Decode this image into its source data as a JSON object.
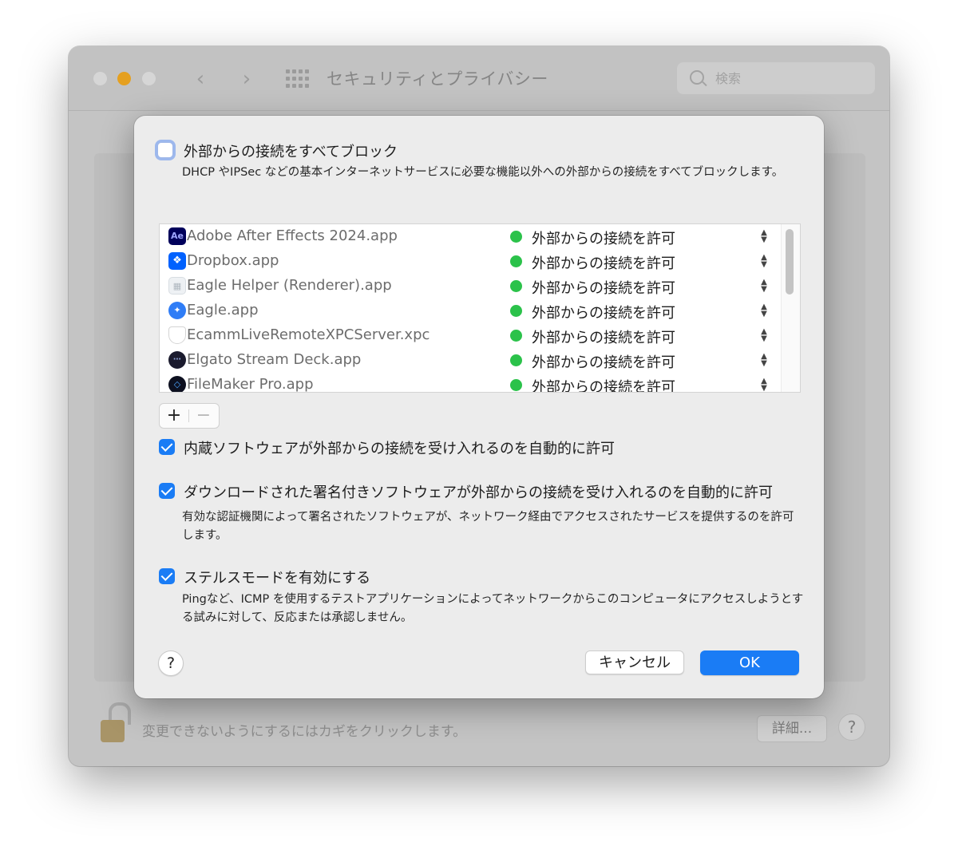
{
  "window": {
    "title": "セキュリティとプライバシー",
    "search": {
      "placeholder": "検索"
    },
    "footer": {
      "lock_text": "変更できないようにするにはカギをクリックします。",
      "detail_label": "詳細...",
      "help_label": "?"
    }
  },
  "sheet": {
    "block_all": {
      "checked": false,
      "label": "外部からの接続をすべてブロック",
      "description": "DHCP やIPSec などの基本インターネットサービスに必要な機能以外への外部からの接続をすべてブロックします。"
    },
    "apps": [
      {
        "name": "Adobe After Effects 2024.app",
        "icon": "after-effects-icon",
        "status": "外部からの接続を許可"
      },
      {
        "name": "Dropbox.app",
        "icon": "dropbox-icon",
        "status": "外部からの接続を許可"
      },
      {
        "name": "Eagle Helper (Renderer).app",
        "icon": "eagle-helper-icon",
        "status": "外部からの接続を許可"
      },
      {
        "name": "Eagle.app",
        "icon": "eagle-icon",
        "status": "外部からの接続を許可"
      },
      {
        "name": "EcammLiveRemoteXPCServer.xpc",
        "icon": "xpc-shield-icon",
        "status": "外部からの接続を許可"
      },
      {
        "name": "Elgato Stream Deck.app",
        "icon": "stream-deck-icon",
        "status": "外部からの接続を許可"
      },
      {
        "name": "FileMaker Pro.app",
        "icon": "filemaker-icon",
        "status": "外部からの接続を許可"
      }
    ],
    "add_label": "+",
    "remove_label": "−",
    "builtin": {
      "checked": true,
      "label": "内蔵ソフトウェアが外部からの接続を受け入れるのを自動的に許可"
    },
    "signed": {
      "checked": true,
      "label": "ダウンロードされた署名付きソフトウェアが外部からの接続を受け入れるのを自動的に許可",
      "description": "有効な認証機関によって署名されたソフトウェアが、ネットワーク経由でアクセスされたサービスを提供するのを許可します。"
    },
    "stealth": {
      "checked": true,
      "label": "ステルスモードを有効にする",
      "description": "Pingなど、ICMP を使用するテストアプリケーションによってネットワークからこのコンピュータにアクセスしようとする試みに対して、反応または承認しません。"
    },
    "help_label": "?",
    "cancel_label": "キャンセル",
    "ok_label": "OK"
  },
  "colors": {
    "accent": "#1a7cf5",
    "status_green": "#2bc24a"
  }
}
